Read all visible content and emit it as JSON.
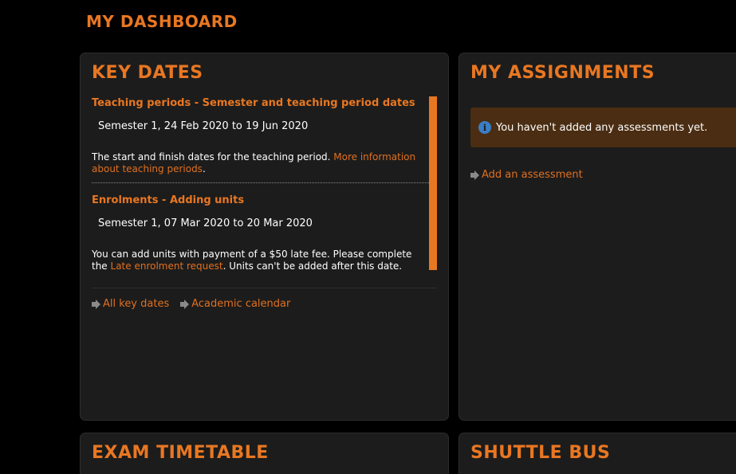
{
  "page": {
    "title": "MY DASHBOARD"
  },
  "key_dates": {
    "title": "KEY DATES",
    "items": [
      {
        "heading": "Teaching periods - Semester and teaching period dates",
        "date": "Semester 1, 24 Feb 2020 to 19 Jun 2020",
        "desc_before": "The start and finish dates for the teaching period. ",
        "desc_link": "More information about teaching periods",
        "desc_after": "."
      },
      {
        "heading": "Enrolments - Adding units",
        "date": "Semester 1, 07 Mar 2020 to 20 Mar 2020",
        "desc_before": "You can add units with payment of a $50 late fee. Please complete the ",
        "desc_link": "Late enrolment request",
        "desc_after": ". Units can't be added after this date."
      }
    ],
    "links": {
      "all_key_dates": "All key dates",
      "academic_calendar": "Academic calendar"
    }
  },
  "assignments": {
    "title": "MY ASSIGNMENTS",
    "notice": "You haven't added any assessments yet.",
    "info_icon_glyph": "i",
    "add_link": "Add an assessment"
  },
  "exam_timetable": {
    "title": "EXAM TIMETABLE"
  },
  "shuttle_bus": {
    "title": "SHUTTLE BUS"
  },
  "colors": {
    "accent": "#e87722",
    "link": "#e0701f",
    "panel_bg": "#1c1c1c",
    "notice_bg": "#4a2d12",
    "info_blue": "#3a7ec4"
  }
}
